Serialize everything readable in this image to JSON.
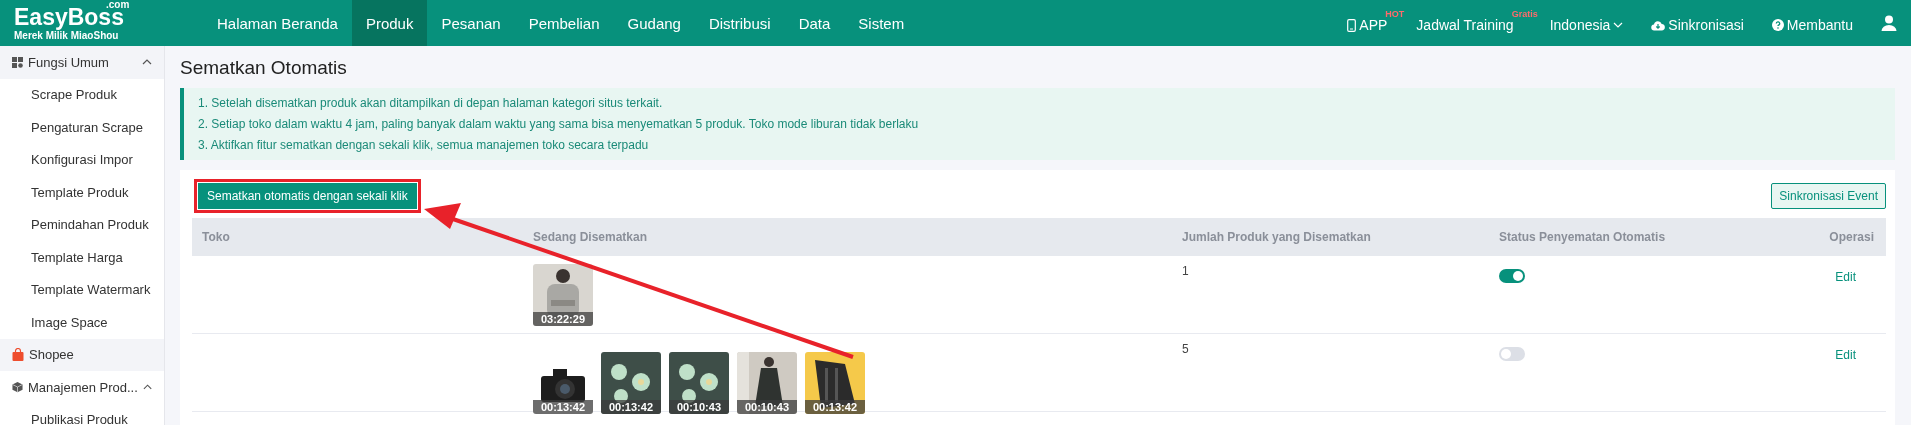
{
  "brand": {
    "name": "EasyBoss",
    "suffix": ".com",
    "tagline": "Merek Milik MiaoShou"
  },
  "nav": [
    {
      "label": "Halaman Beranda",
      "selected": false
    },
    {
      "label": "Produk",
      "selected": true
    },
    {
      "label": "Pesanan",
      "selected": false
    },
    {
      "label": "Pembelian",
      "selected": false
    },
    {
      "label": "Gudang",
      "selected": false
    },
    {
      "label": "Distribusi",
      "selected": false
    },
    {
      "label": "Data",
      "selected": false
    },
    {
      "label": "Sistem",
      "selected": false
    }
  ],
  "header_actions": [
    {
      "kind": "app",
      "label": "APP",
      "badge": "HOT"
    },
    {
      "kind": "training",
      "label": "Jadwal Training",
      "badge": "Gratis"
    },
    {
      "kind": "language",
      "label": "Indonesia"
    },
    {
      "kind": "sync",
      "label": "Sinkronisasi"
    },
    {
      "kind": "help",
      "label": "Membantu"
    },
    {
      "kind": "user"
    }
  ],
  "sidebar": [
    {
      "kind": "group",
      "label": "Fungsi Umum",
      "expanded": true,
      "highlighted": true,
      "children": [
        {
          "label": "Scrape Produk"
        },
        {
          "label": "Pengaturan Scrape"
        },
        {
          "label": "Konfigurasi Impor"
        },
        {
          "label": "Template Produk"
        },
        {
          "label": "Pemindahan Produk"
        },
        {
          "label": "Template Harga"
        },
        {
          "label": "Template Watermark"
        },
        {
          "label": "Image Space"
        }
      ]
    },
    {
      "kind": "shop",
      "label": "Shopee",
      "highlighted": true
    },
    {
      "kind": "group",
      "label": "Manajemen Prod...",
      "expanded": true,
      "highlighted": false,
      "children": [
        {
          "label": "Publikasi Produk"
        }
      ]
    }
  ],
  "page_title": "Sematkan Otomatis",
  "notes": [
    "1. Setelah disematkan produk akan ditampilkan di depan halaman kategori situs terkait.",
    "2. Setiap toko dalam waktu 4 jam, paling banyak dalam waktu yang sama bisa menyematkan 5 produk. Toko mode liburan tidak berlaku",
    "3. Aktifkan fitur sematkan dengan sekali klik, semua manajemen toko secara terpadu"
  ],
  "primary_button": "Sematkan otomatis dengan sekali klik",
  "sync_button": "Sinkronisasi Event",
  "table": {
    "columns": [
      "Toko",
      "Sedang Disematkan",
      "Jumlah Produk yang Disematkan",
      "Status Penyematan Otomatis",
      "Operasi"
    ],
    "rows": [
      {
        "pinned": [
          {
            "kind": "picture",
            "time": "03:22:29"
          }
        ],
        "count": "1",
        "auto_on": true,
        "action": "Edit"
      },
      {
        "pinned": [
          {
            "kind": "picture",
            "time": "00:13:42"
          },
          {
            "kind": "picture",
            "time": "00:13:42"
          },
          {
            "kind": "picture",
            "time": "00:10:43"
          },
          {
            "kind": "picture",
            "time": "00:10:43"
          },
          {
            "kind": "picture",
            "time": "00:13:42"
          }
        ],
        "count": "5",
        "auto_on": false,
        "action": "Edit"
      }
    ]
  },
  "annotation": {
    "kind": "arrow"
  }
}
